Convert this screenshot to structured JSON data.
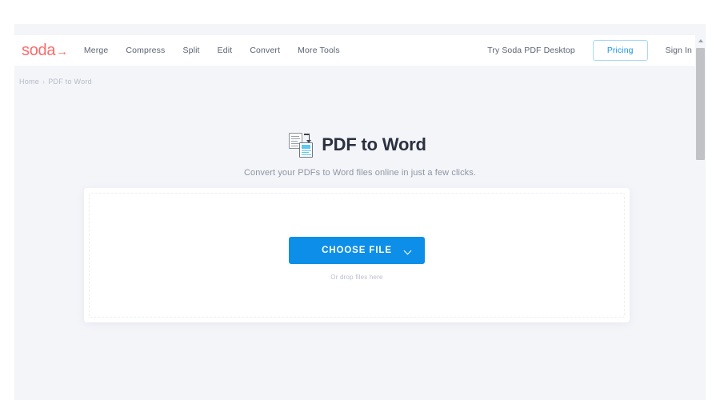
{
  "header": {
    "logo_text": "soda",
    "logo_arrow": "→",
    "nav": [
      {
        "label": "Merge"
      },
      {
        "label": "Compress"
      },
      {
        "label": "Split"
      },
      {
        "label": "Edit"
      },
      {
        "label": "Convert"
      },
      {
        "label": "More Tools"
      }
    ],
    "desktop_link": "Try Soda PDF Desktop",
    "pricing_label": "Pricing",
    "signin_label": "Sign In"
  },
  "breadcrumb": {
    "home": "Home",
    "separator": "›",
    "current": "PDF to Word"
  },
  "hero": {
    "title": "PDF to Word",
    "subtitle": "Convert your PDFs to Word files online in just a few clicks.",
    "icon": "pdf-to-word-convert-icon"
  },
  "upload": {
    "button_label": "CHOOSE FILE",
    "dropdown_icon": "chevron-down-icon",
    "drop_hint": "Or drop files here"
  },
  "scrollbar": {
    "up_arrow_icon": "scroll-up-arrow-icon"
  },
  "colors": {
    "brand_coral": "#fa6b6b",
    "accent_blue": "#0d8ee8",
    "pricing_border": "#a9d8f7",
    "page_background": "#f4f5f9",
    "card_background": "#ffffff",
    "title_text": "#2b3140",
    "muted_text": "#8e95a3"
  }
}
